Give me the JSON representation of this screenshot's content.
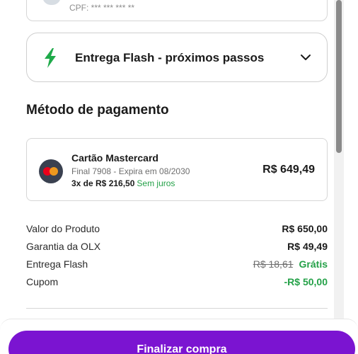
{
  "buyer_card": {
    "cpf_text": "CPF: *** *** *** **"
  },
  "delivery": {
    "title": "Entrega Flash - próximos passos",
    "icon": "lightning-bolt-icon"
  },
  "payment": {
    "section_title": "Método de pagamento",
    "card_name": "Cartão Mastercard",
    "card_expiry": "Final 7908 - Expira em 08/2030",
    "installments": "3x de R$ 216,50",
    "installments_note": "Sem juros",
    "total": "R$ 649,49"
  },
  "summary": {
    "items": [
      {
        "label": "Valor do Produto",
        "value": "R$ 650,00"
      },
      {
        "label": "Garantia da OLX",
        "value": "R$ 49,49"
      },
      {
        "label": "Entrega Flash",
        "old_value": "R$ 18,61",
        "value": "Grátis"
      },
      {
        "label": "Cupom",
        "value": "-R$ 50,00"
      }
    ]
  },
  "cta": {
    "label": "Finalizar compra"
  },
  "colors": {
    "brand": "#7b14d1",
    "success": "#24a148",
    "bolt": "#1faa4a"
  }
}
